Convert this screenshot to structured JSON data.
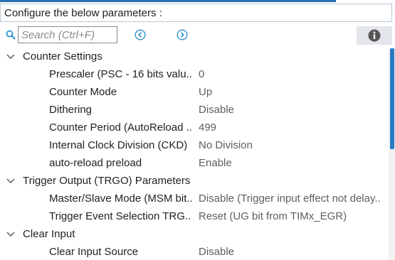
{
  "header": {
    "title": "Configure the below parameters :"
  },
  "toolbar": {
    "search_placeholder": "Search (Ctrl+F)",
    "icons": {
      "search": "search-icon",
      "prev": "arrow-left-circle-icon",
      "next": "arrow-right-circle-icon",
      "info": "info-icon"
    }
  },
  "colors": {
    "accent": "#2a6fb0",
    "nav_icon": "#2a8fd0",
    "scroll_thumb": "#2a79c5"
  },
  "groups": [
    {
      "label": "Counter Settings",
      "params": [
        {
          "label": "Prescaler (PSC - 16 bits valu..",
          "value": "0"
        },
        {
          "label": "Counter Mode",
          "value": "Up"
        },
        {
          "label": "Dithering",
          "value": "Disable"
        },
        {
          "label": "Counter Period (AutoReload ..",
          "value": "499"
        },
        {
          "label": "Internal Clock Division (CKD)",
          "value": "No Division"
        },
        {
          "label": "auto-reload preload",
          "value": "Enable"
        }
      ]
    },
    {
      "label": "Trigger Output (TRGO) Parameters",
      "params": [
        {
          "label": "Master/Slave Mode (MSM bit..",
          "value": "Disable (Trigger input effect not delay.."
        },
        {
          "label": "Trigger Event Selection TRG..",
          "value": "Reset (UG bit from TIMx_EGR)"
        }
      ]
    },
    {
      "label": "Clear Input",
      "params": [
        {
          "label": "Clear Input Source",
          "value": "Disable"
        }
      ]
    }
  ]
}
